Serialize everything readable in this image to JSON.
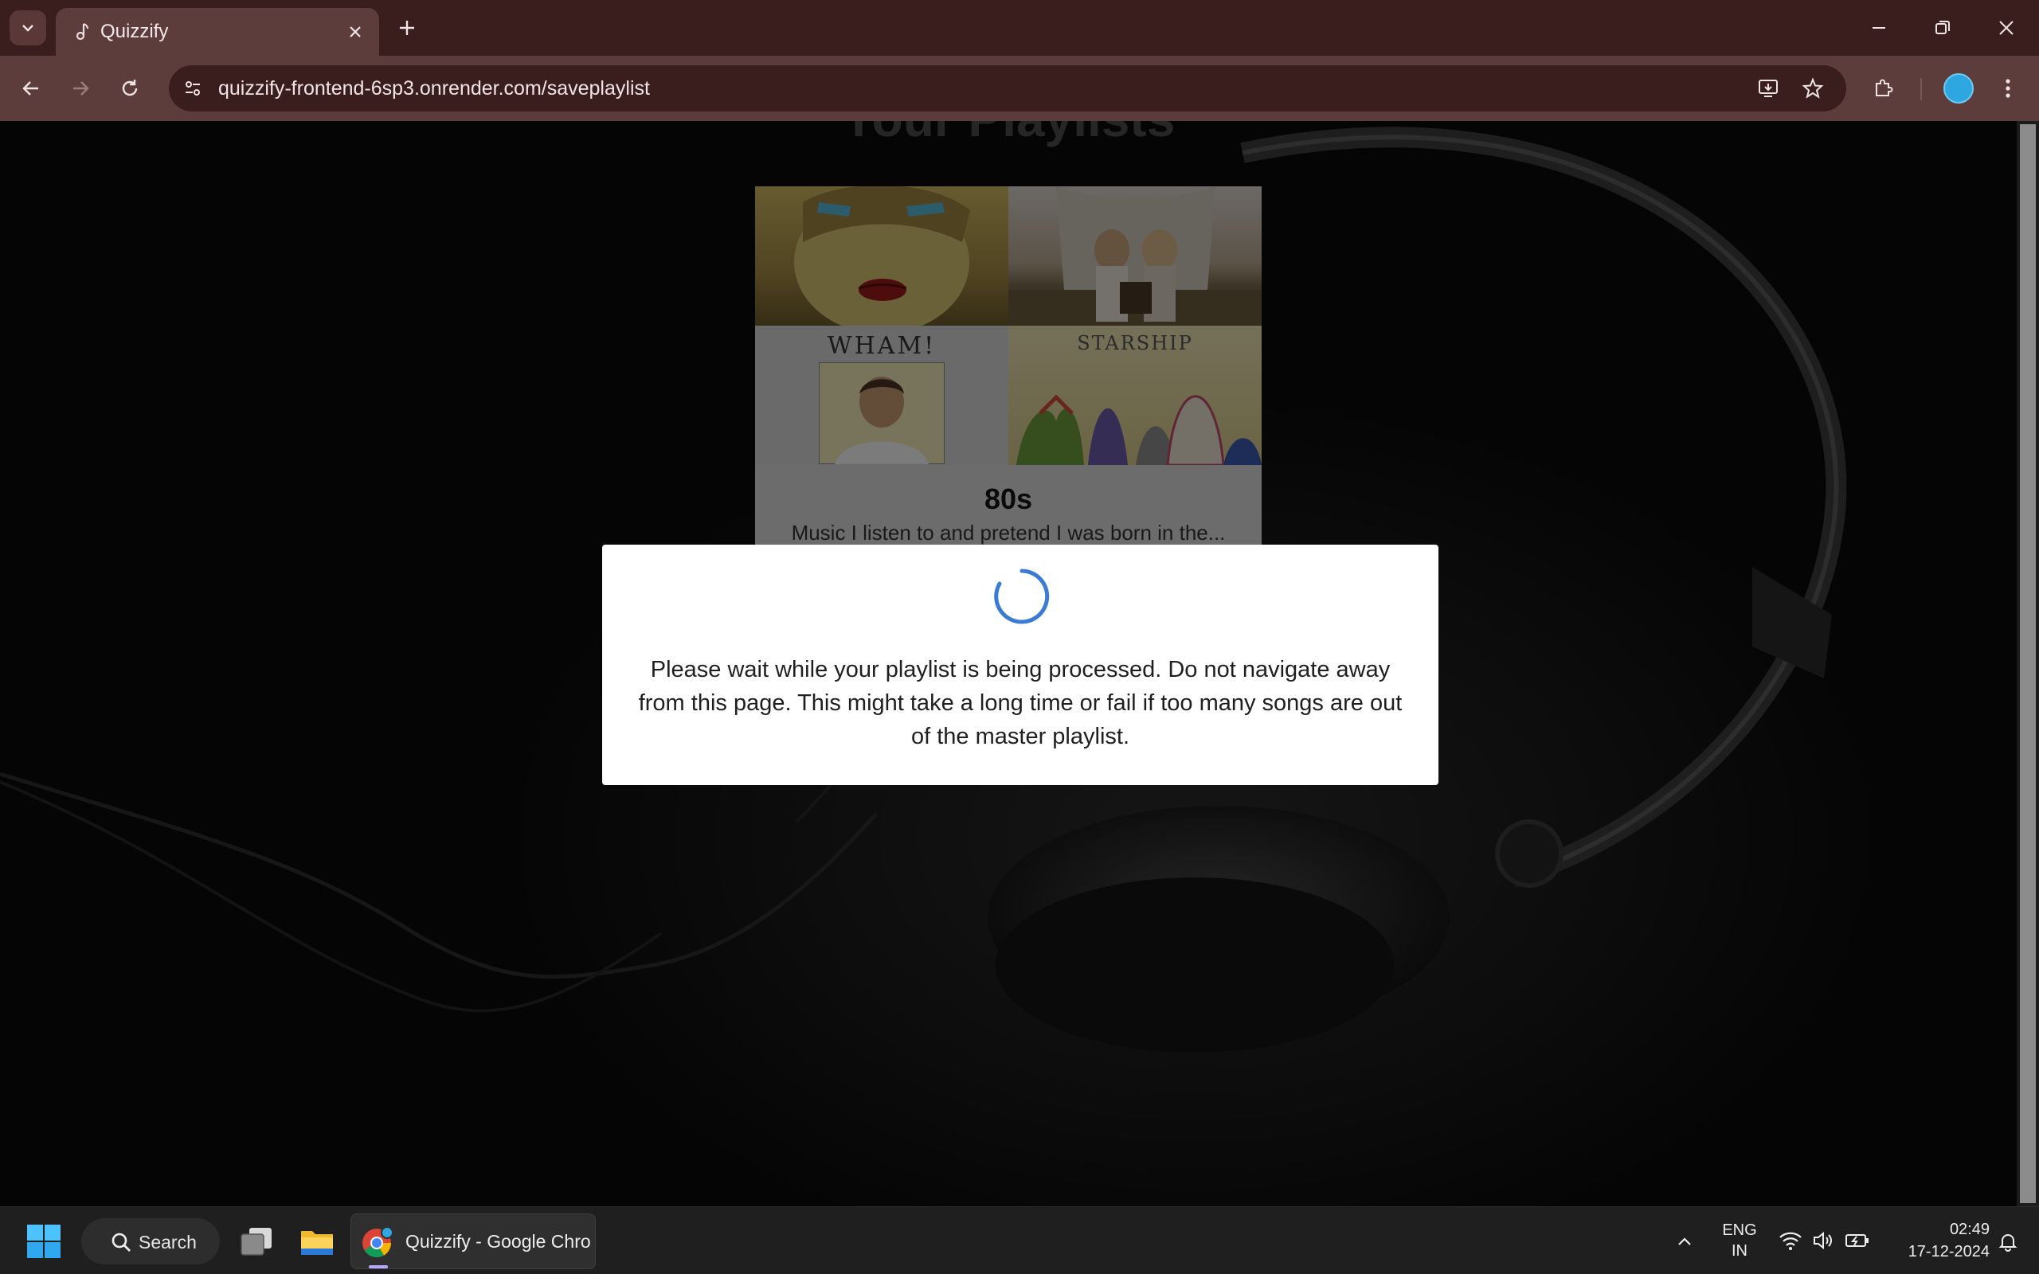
{
  "browser": {
    "tab_title": "Quizzify",
    "url": "quizzify-frontend-6sp3.onrender.com/saveplaylist"
  },
  "page": {
    "heading": "Your Playlists",
    "playlist": {
      "name": "80s",
      "description": "Music I listen to and pretend I was born in the...",
      "covers": [
        "madonna-cover",
        "abba-cover",
        "wham-cover",
        "starship-cover"
      ],
      "cover_titles": {
        "wham": "WHAM!",
        "starship": "STARSHIP"
      }
    }
  },
  "modal": {
    "message": "Please wait while your playlist is being processed. Do not navigate away from this page. This might take a long time or fail if too many songs are out of the master playlist."
  },
  "taskbar": {
    "search_label": "Search",
    "chrome_label": "Quizzify - Google Chrome",
    "lang_line1": "ENG",
    "lang_line2": "IN",
    "time": "02:49",
    "date": "17-12-2024"
  },
  "colors": {
    "spinner": "#3a7bd5",
    "tab_bar": "#3a1e1e",
    "toolbar": "#5d3c3c"
  }
}
